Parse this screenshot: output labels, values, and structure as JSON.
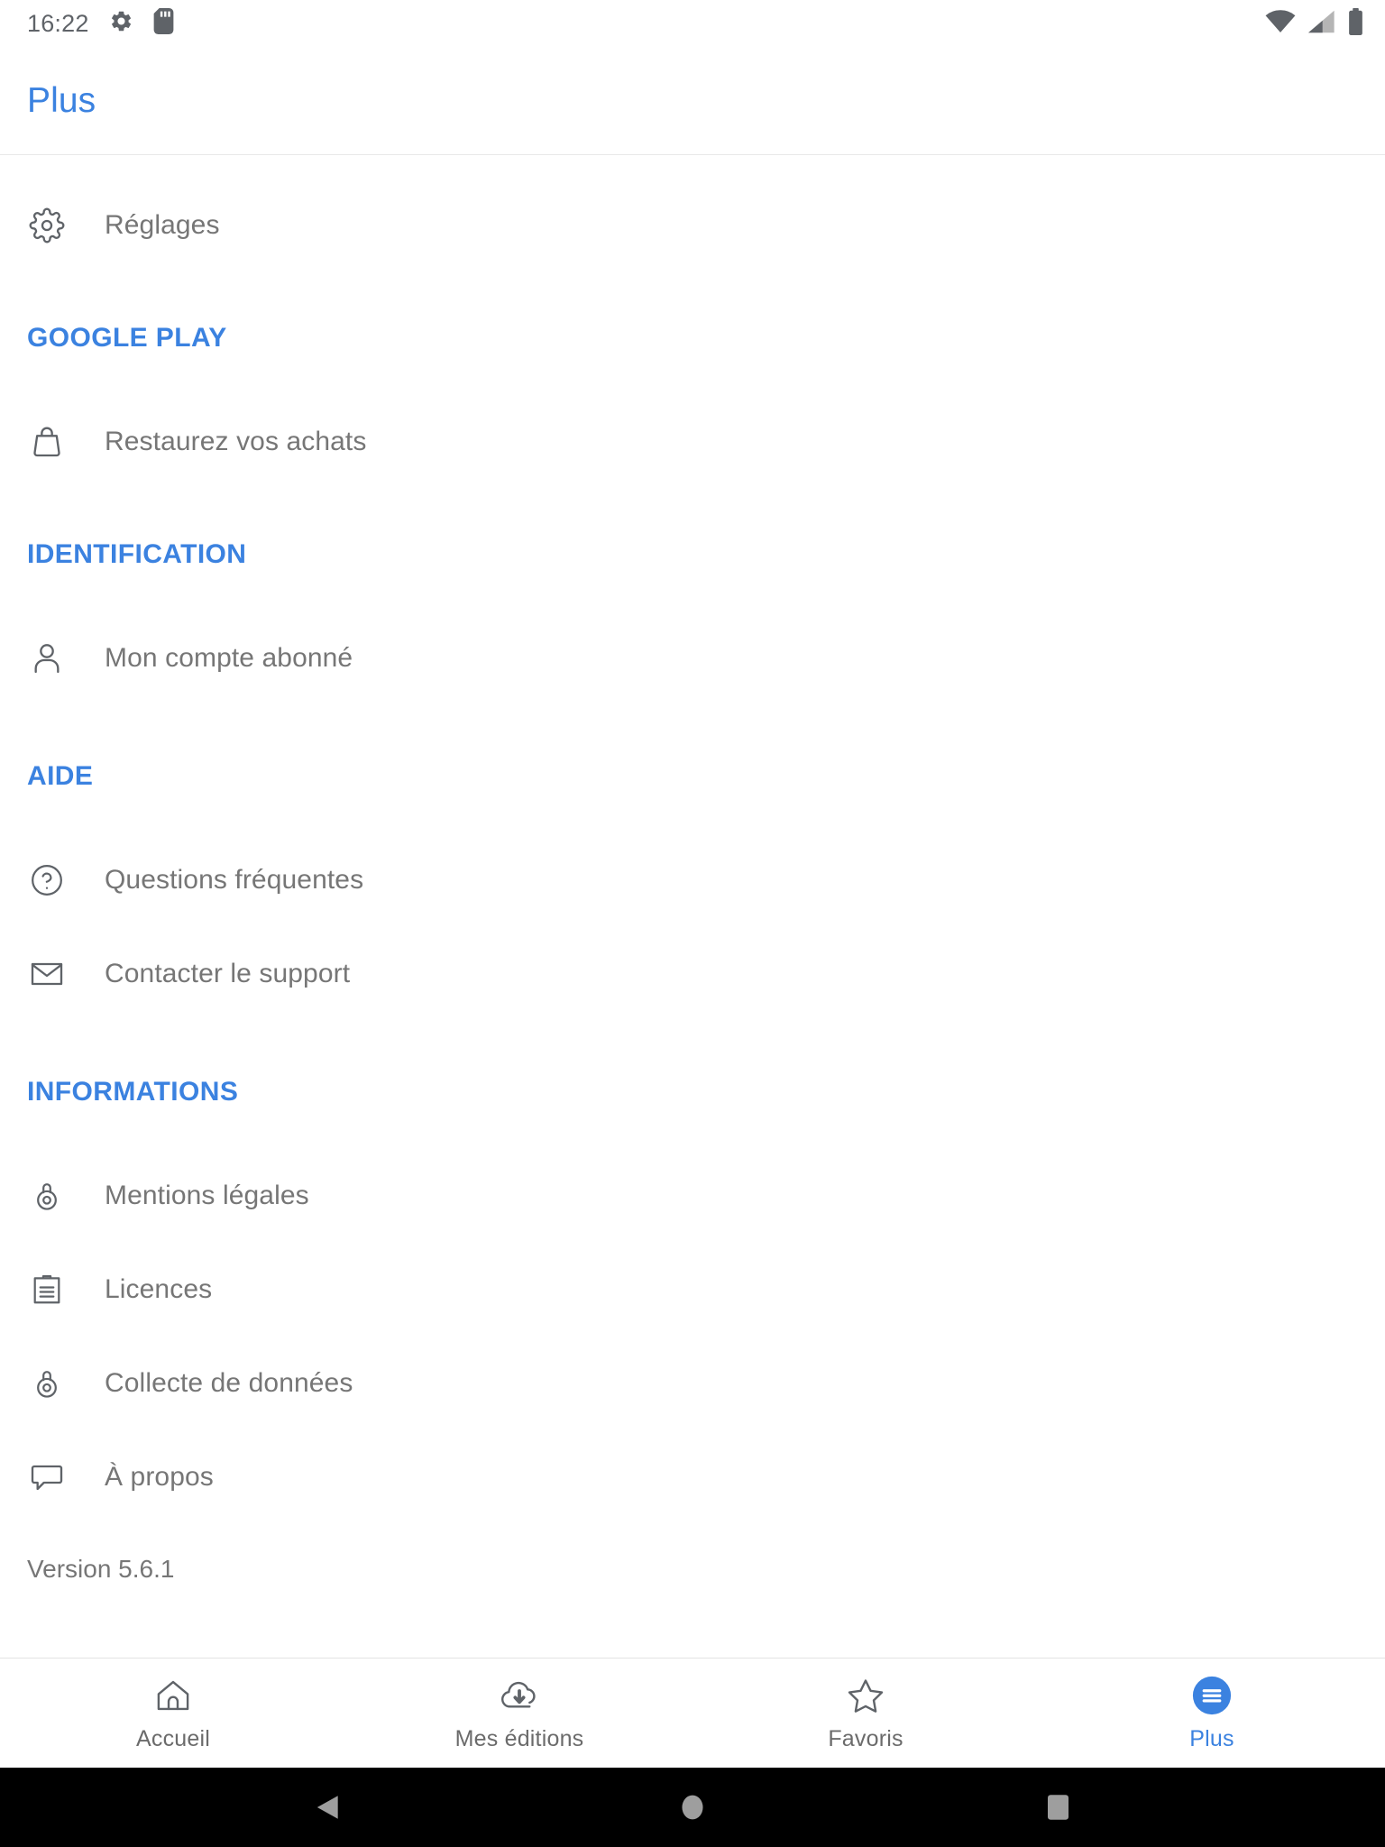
{
  "status_bar": {
    "time": "16:22",
    "icons": [
      "settings-gear-icon",
      "sd-card-icon",
      "wifi-icon",
      "cellular-signal-icon",
      "battery-icon"
    ]
  },
  "header": {
    "title": "Plus",
    "title_color": "#3b82e0"
  },
  "content": {
    "top_items": [
      {
        "label": "Réglages",
        "icon": "gear-icon"
      }
    ],
    "sections": [
      {
        "title": "GOOGLE PLAY",
        "items": [
          {
            "label": "Restaurez vos achats",
            "icon": "shopping-bag-icon"
          }
        ]
      },
      {
        "title": "IDENTIFICATION",
        "items": [
          {
            "label": "Mon compte abonné",
            "icon": "person-icon"
          }
        ]
      },
      {
        "title": "AIDE",
        "items": [
          {
            "label": "Questions fréquentes",
            "icon": "help-circle-icon"
          },
          {
            "label": "Contacter le support",
            "icon": "envelope-icon"
          }
        ]
      },
      {
        "title": "INFORMATIONS",
        "items": [
          {
            "label": "Mentions légales",
            "icon": "lock-icon"
          },
          {
            "label": "Licences",
            "icon": "clipboard-icon"
          },
          {
            "label": "Collecte de données",
            "icon": "lock-icon"
          },
          {
            "label": "À propos",
            "icon": "speech-bubble-icon"
          }
        ]
      }
    ],
    "version": "Version 5.6.1"
  },
  "tabbar": {
    "accent_color": "#3b82e0",
    "inactive_color": "#6b6b6b",
    "tabs": [
      {
        "label": "Accueil",
        "icon": "home-icon",
        "active": false
      },
      {
        "label": "Mes éditions",
        "icon": "cloud-download-icon",
        "active": false
      },
      {
        "label": "Favoris",
        "icon": "star-icon",
        "active": false
      },
      {
        "label": "Plus",
        "icon": "hamburger-menu-icon",
        "active": true
      }
    ]
  },
  "navbar": {
    "buttons": [
      "back-triangle-icon",
      "home-circle-icon",
      "recents-square-icon"
    ]
  }
}
